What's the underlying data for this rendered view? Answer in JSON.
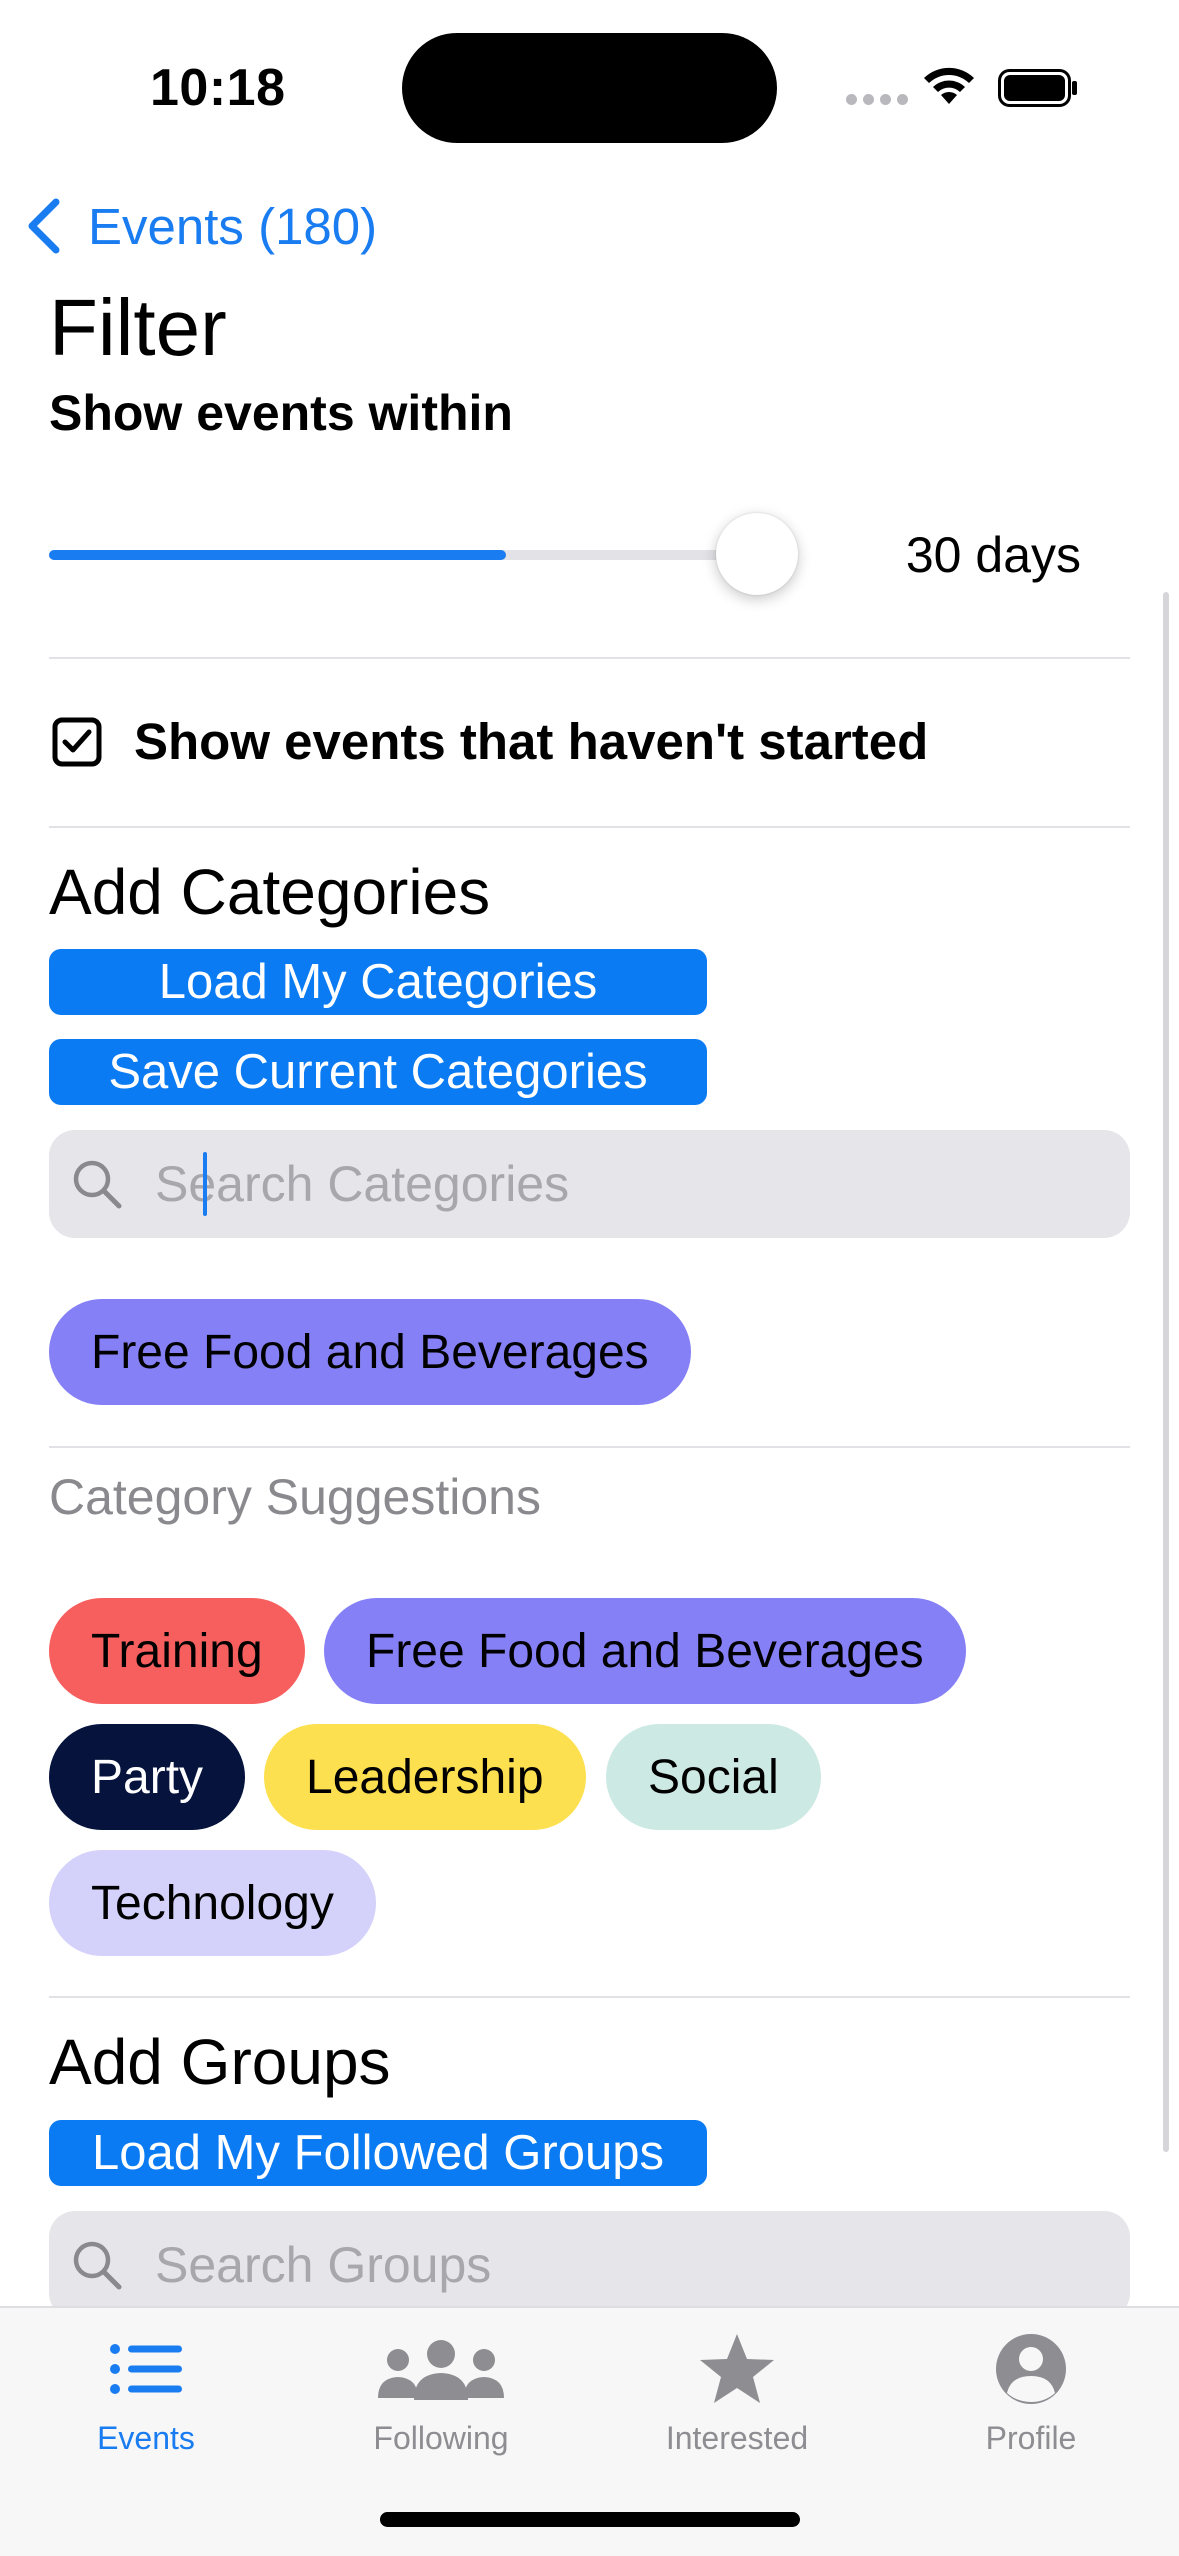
{
  "status_bar": {
    "time": "10:18"
  },
  "nav": {
    "back_label": "Events (180)"
  },
  "filter": {
    "title": "Filter",
    "within_label": "Show events within",
    "slider_value_label": "30 days",
    "slider_fraction": 0.645,
    "show_not_started_label": "Show events that haven't started",
    "show_not_started_checked": true
  },
  "categories": {
    "heading": "Add Categories",
    "load_button": "Load My Categories",
    "save_button": "Save Current Categories",
    "search_placeholder": "Search Categories",
    "selected": [
      {
        "label": "Free Food and Beverages",
        "color": "#8680f7"
      }
    ],
    "suggestions_heading": "Category Suggestions",
    "suggestions": [
      {
        "label": "Training",
        "color": "#f75f5f",
        "text_color": "#000000"
      },
      {
        "label": "Free Food and Beverages",
        "color": "#8680f7",
        "text_color": "#000000"
      },
      {
        "label": "Party",
        "color": "#05133d",
        "text_color": "#ffffff"
      },
      {
        "label": "Leadership",
        "color": "#fde04f",
        "text_color": "#000000"
      },
      {
        "label": "Social",
        "color": "#cde9e4",
        "text_color": "#000000"
      },
      {
        "label": "Technology",
        "color": "#d4d2fa",
        "text_color": "#000000"
      }
    ]
  },
  "groups": {
    "heading": "Add Groups",
    "load_button": "Load My Followed Groups",
    "search_placeholder": "Search Groups"
  },
  "tab_bar": {
    "tabs": [
      {
        "label": "Events",
        "icon": "list-icon",
        "active": true
      },
      {
        "label": "Following",
        "icon": "people-icon",
        "active": false
      },
      {
        "label": "Interested",
        "icon": "star-icon",
        "active": false
      },
      {
        "label": "Profile",
        "icon": "person-circle-icon",
        "active": false
      }
    ]
  },
  "colors": {
    "accent": "#1a7cf1",
    "button": "#0a7bf2"
  }
}
